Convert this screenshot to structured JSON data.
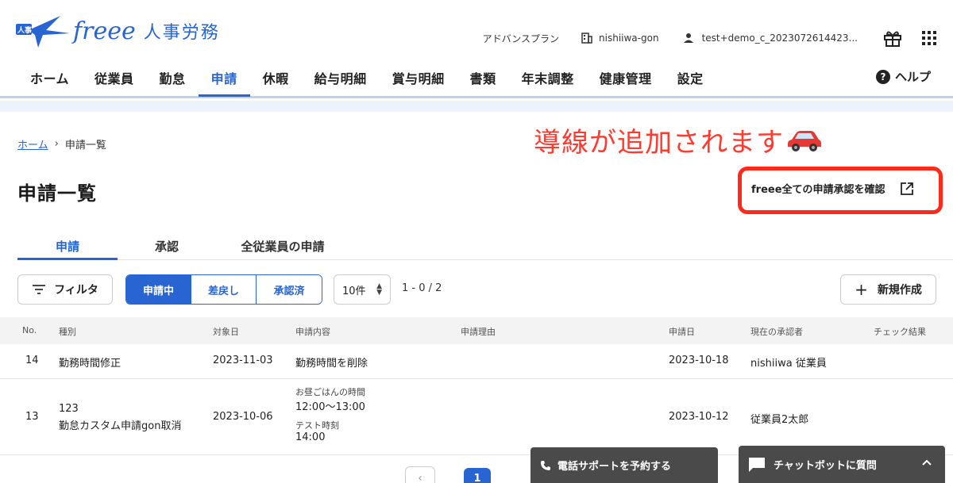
{
  "header": {
    "logo_badge": "人事",
    "logo_text": "freee",
    "logo_sub": "人事労務",
    "plan": "アドバンスプラン",
    "company": "nishiiwa-gon",
    "user": "test+demo_c_2023072614423..."
  },
  "nav": {
    "items": [
      {
        "label": "ホーム"
      },
      {
        "label": "従業員"
      },
      {
        "label": "勤怠"
      },
      {
        "label": "申請"
      },
      {
        "label": "休暇"
      },
      {
        "label": "給与明細"
      },
      {
        "label": "賞与明細"
      },
      {
        "label": "書類"
      },
      {
        "label": "年末調整"
      },
      {
        "label": "健康管理"
      },
      {
        "label": "設定"
      }
    ],
    "active_index": 3,
    "help": "ヘルプ"
  },
  "breadcrumb": {
    "home": "ホーム",
    "current": "申請一覧"
  },
  "annotation": "導線が追加されます",
  "page_title": "申請一覧",
  "confirm_button": "freee全ての申請承認を確認",
  "tabs": [
    {
      "label": "申請"
    },
    {
      "label": "承認"
    },
    {
      "label": "全従業員の申請"
    }
  ],
  "toolbar": {
    "filter": "フィルタ",
    "segments": [
      {
        "label": "申請中"
      },
      {
        "label": "差戻し"
      },
      {
        "label": "承認済"
      }
    ],
    "per_page": "10件",
    "range": "1 - 0 / 2",
    "new": "新規作成"
  },
  "table": {
    "headers": {
      "no": "No.",
      "type": "種別",
      "target_date": "対象日",
      "content": "申請内容",
      "reason": "申請理由",
      "applied_date": "申請日",
      "approver": "現在の承認者",
      "check": "チェック結果"
    },
    "rows": [
      {
        "no": "14",
        "type": "勤務時間修正",
        "target_date": "2023-11-03",
        "content": "勤務時間を削除",
        "applied_date": "2023-10-18",
        "approver": "nishiiwa 従業員"
      },
      {
        "no": "13",
        "type_line1": "123",
        "type_line2": "勤怠カスタム申請gon取消",
        "target_date": "2023-10-06",
        "content_label1": "お昼ごはんの時間",
        "content_value1": "12:00〜13:00",
        "content_label2": "テスト時刻",
        "content_value2": "14:00",
        "applied_date": "2023-10-12",
        "approver": "従業員2太郎"
      }
    ]
  },
  "bottom": {
    "page": "1",
    "phone_support": "電話サポートを予約する",
    "chatbot": "チャットボットに質問"
  }
}
